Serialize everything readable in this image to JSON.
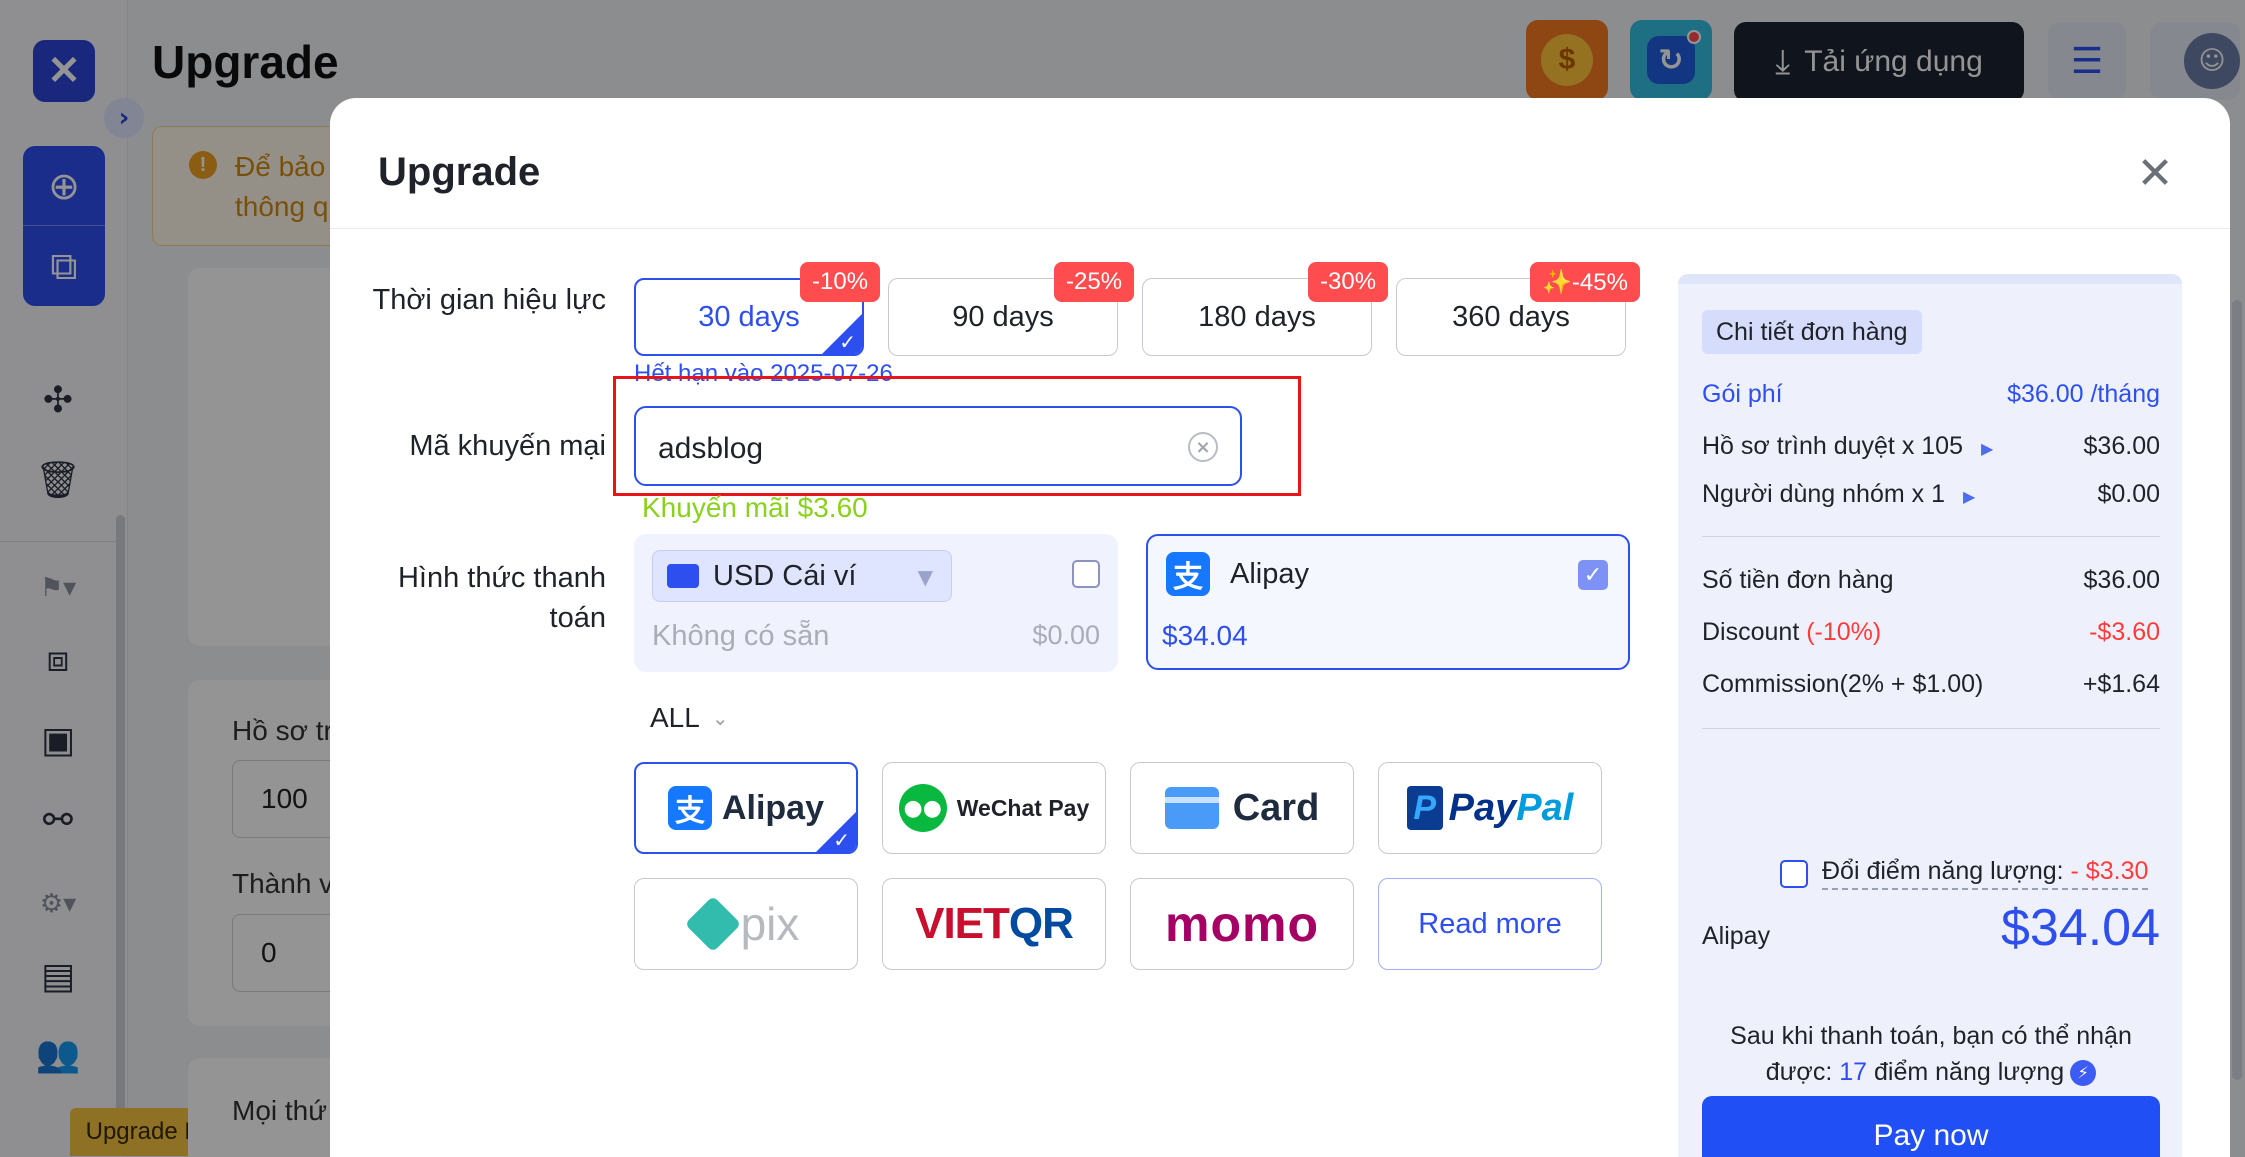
{
  "background": {
    "page_title": "Upgrade",
    "warning_line1": "Để bảo",
    "warning_line2": "thông q",
    "field1_label": "Hồ sơ tr",
    "field1_value": "100",
    "field2_label": "Thành v",
    "field2_value": "0",
    "field3_label": "Mọi thứ",
    "upgrade_plan": "Upgrade Plan",
    "download_app": "Tải ứng dụng"
  },
  "modal": {
    "title": "Upgrade",
    "close_icon": "close-icon",
    "duration_label": "Thời gian hiệu lực",
    "durations": [
      {
        "label": "30 days",
        "discount": "-10%",
        "selected": true
      },
      {
        "label": "90 days",
        "discount": "-25%",
        "selected": false
      },
      {
        "label": "180 days",
        "discount": "-30%",
        "selected": false
      },
      {
        "label": "360 days",
        "discount": "✨-45%",
        "selected": false
      }
    ],
    "expiry_text": "Hết hạn vào 2025-07-26",
    "promo_label": "Mã khuyến mại",
    "promo_value": "adsblog",
    "promo_note": "Khuyến mãi $3.60",
    "payment_label": "Hình thức thanh toán",
    "wallet": {
      "name": "USD Cái ví",
      "status": "Không có sẵn",
      "amount": "$0.00"
    },
    "selected_method": {
      "name": "Alipay",
      "amount": "$34.04"
    },
    "filter": "ALL",
    "methods": {
      "alipay": "Alipay",
      "wechat": "WeChat Pay",
      "card": "Card",
      "paypal_1": "Pay",
      "paypal_2": "Pal",
      "pix": "pix",
      "vietqr_1": "VIET",
      "vietqr_2": "QR",
      "momo": "momo",
      "read_more": "Read more"
    }
  },
  "order": {
    "title": "Chi tiết đơn hàng",
    "plan_label": "Gói phí",
    "plan_value": "$36.00 /tháng",
    "profiles_label": "Hồ sơ trình duyệt x 105",
    "profiles_value": "$36.00",
    "members_label": "Người dùng nhóm x 1",
    "members_value": "$0.00",
    "order_amount_label": "Số tiền đơn hàng",
    "order_amount_value": "$36.00",
    "discount_label": "Discount",
    "discount_pct": "(-10%)",
    "discount_value": "-$3.60",
    "commission_label": "Commission(2% + $1.00)",
    "commission_value": "+$1.64",
    "exchange_label": "Đổi điểm năng lượng:",
    "exchange_value": " - $3.30",
    "method": "Alipay",
    "total": "$34.04",
    "info_line1": "Sau khi thanh toán, bạn có thể nhận",
    "info_line2_pre": "được:",
    "info_points": "17",
    "info_line2_post": "điểm năng lượng",
    "pay_now": "Pay now"
  }
}
